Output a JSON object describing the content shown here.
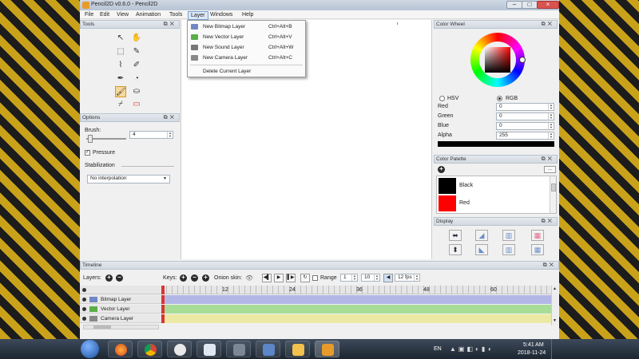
{
  "window": {
    "title": "Pencil2D v0.6.0 - Pencil2D"
  },
  "menubar": {
    "items": [
      "File",
      "Edit",
      "View",
      "Animation",
      "Tools",
      "Layer",
      "Windows",
      "Help"
    ]
  },
  "layer_menu": {
    "items": [
      {
        "label": "New Bitmap Layer",
        "shortcut": "Ctrl+Alt+B"
      },
      {
        "label": "New Vector Layer",
        "shortcut": "Ctrl+Alt+V"
      },
      {
        "label": "New Sound Layer",
        "shortcut": "Ctrl+Alt+W"
      },
      {
        "label": "New Camera Layer",
        "shortcut": "Ctrl+Alt+C"
      }
    ],
    "delete_label": "Delete Current Layer"
  },
  "tools": {
    "title": "Tools"
  },
  "options": {
    "title": "Options",
    "brush_label": "Brush:",
    "brush_value": "4",
    "pressure_label": "Pressure",
    "pressure_checked": true,
    "stabilization_label": "Stabilization",
    "interpolation_value": "No interpolation"
  },
  "color_wheel": {
    "title": "Color Wheel",
    "hsv_label": "HSV",
    "rgb_label": "RGB",
    "selected_mode": "RGB",
    "fields": [
      {
        "label": "Red",
        "value": "0"
      },
      {
        "label": "Green",
        "value": "0"
      },
      {
        "label": "Blue",
        "value": "0"
      },
      {
        "label": "Alpha",
        "value": "255"
      }
    ],
    "current_color": "#000000"
  },
  "color_palette": {
    "title": "Color Palette",
    "more_label": "...",
    "swatches": [
      {
        "name": "Black",
        "color": "#000000"
      },
      {
        "name": "Red",
        "color": "#ff0000"
      }
    ]
  },
  "display": {
    "title": "Display"
  },
  "timeline": {
    "title": "Timeline",
    "layers_label": "Layers:",
    "keys_label": "Keys:",
    "onion_label": "Onion skin:",
    "range_label": "Range",
    "range_start": "1",
    "range_end": "10",
    "fps": "12 fps",
    "ticks": [
      "12",
      "24",
      "36",
      "48",
      "60"
    ],
    "layers": [
      {
        "name": "Bitmap Layer",
        "color": "#b3b7e6"
      },
      {
        "name": "Vector Layer",
        "color": "#a8dd98"
      },
      {
        "name": "Camera Layer",
        "color": "#ece9a5"
      }
    ]
  },
  "taskbar": {
    "language": "EN",
    "time": "5:41 AM",
    "date": "2018-11-24"
  }
}
